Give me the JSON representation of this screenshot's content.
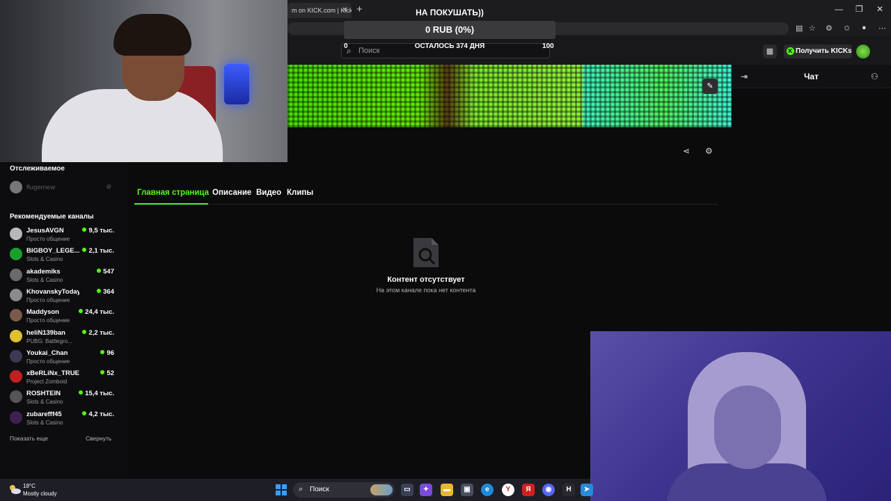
{
  "browser": {
    "tab_title": "m on KICK.com | Kick",
    "tab_close": "✕",
    "new_tab": "+",
    "win_minimize": "—",
    "win_restore": "❐",
    "win_close": "✕"
  },
  "donation": {
    "title": "НА ПОКУШАТЬ))",
    "amount": "0 RUB (0%)",
    "remaining": "ОСТАЛОСЬ 374 ДНЯ",
    "min": "0",
    "max": "100"
  },
  "header": {
    "search_placeholder": "Поиск",
    "get_kicks": "Получить KICKs"
  },
  "chat": {
    "title": "Чат"
  },
  "sidebar": {
    "followed_title": "Отслеживаемое",
    "followed": [
      {
        "name": "flugernew"
      }
    ],
    "recommended_title": "Рекомендуемые каналы",
    "channels": [
      {
        "name": "JesusAVGN",
        "category": "Просто общение",
        "viewers": "9,5 тыс.",
        "color": "#b8b8b8"
      },
      {
        "name": "BIGBOY_LEGE...",
        "category": "Slots & Casino",
        "viewers": "2,1 тыс.",
        "color": "#1aa02a"
      },
      {
        "name": "akademiks",
        "category": "Slots & Casino",
        "viewers": "547",
        "color": "#6a6a6a"
      },
      {
        "name": "KhovanskyToday",
        "category": "Просто общение",
        "viewers": "364",
        "color": "#8a8a8a"
      },
      {
        "name": "Maddyson",
        "category": "Просто общение",
        "viewers": "24,4 тыс.",
        "color": "#7a5a4a"
      },
      {
        "name": "heliN139ban",
        "category": "PUBG: Battlegro...",
        "viewers": "2,2 тыс.",
        "color": "#e0c030"
      },
      {
        "name": "Youkai_Chan",
        "category": "Просто общение",
        "viewers": "96",
        "color": "#3a3a50"
      },
      {
        "name": "xBeRLiNx_TRUE",
        "category": "Project Zomboid",
        "viewers": "52",
        "color": "#c02020"
      },
      {
        "name": "ROSHTEIN",
        "category": "Slots & Casino",
        "viewers": "15,4 тыс.",
        "color": "#555"
      },
      {
        "name": "zubarefff45",
        "category": "Slots & Casino",
        "viewers": "4,2 тыс.",
        "color": "#402050"
      }
    ],
    "show_more": "Показать еще",
    "collapse": "Свернуть"
  },
  "content": {
    "tabs": [
      "Главная страница",
      "Описание",
      "Видео",
      "Клипы"
    ],
    "empty_title": "Контент отсутствует",
    "empty_subtitle": "На этом канале пока нет контента"
  },
  "taskbar": {
    "temperature": "18°C",
    "weather": "Mostly cloudy",
    "search": "Поиск"
  },
  "colors": {
    "accent": "#53fc18"
  }
}
